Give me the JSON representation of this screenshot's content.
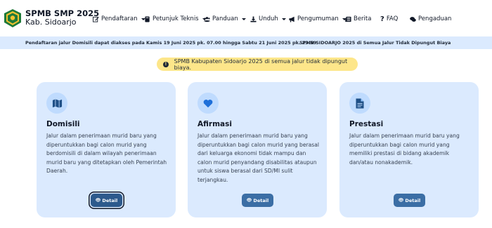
{
  "brand": {
    "title": "SPMB SMP 2025",
    "subtitle": "Kab. Sidoarjo"
  },
  "nav": {
    "items": [
      {
        "label": "Pendaftaran",
        "icon": "edit-icon",
        "dropdown": true
      },
      {
        "label": "Petunjuk Teknis",
        "icon": "book-icon",
        "dropdown": true
      },
      {
        "label": "Panduan",
        "icon": "users-icon",
        "dropdown": true
      },
      {
        "label": "Unduh",
        "icon": "download-icon",
        "dropdown": true
      },
      {
        "label": "Pengumuman",
        "icon": "megaphone-icon",
        "dropdown": true
      },
      {
        "label": "Berita",
        "icon": "newspaper-icon",
        "dropdown": false
      },
      {
        "label": "FAQ",
        "icon": "question-icon",
        "dropdown": false
      },
      {
        "label": "Pengaduan",
        "icon": "comments-icon",
        "dropdown": false
      }
    ]
  },
  "ticker": {
    "items": [
      "Pendaftaran jalur Domisili dapat diakses pada Kamis 19 Juni 2025 pk. 07.00 hingga Sabtu 21 Juni 2025 pk. 23.59",
      "SPMB SIDOARJO 2025 di Semua Jalur Tidak Dipungut Biaya"
    ]
  },
  "alert": {
    "text": "SPMB Kabupaten Sidoarjo 2025 di semua jalur tidak dipungut biaya.",
    "icon": "warning-icon"
  },
  "cards": [
    {
      "title": "Domisili",
      "icon": "map-icon",
      "description": "Jalur dalam penerimaan murid baru yang diperuntukkan bagi calon murid yang berdomisili di dalam wilayah penerimaan murid baru yang ditetapkan oleh Pemerintah Daerah.",
      "button": "Detail"
    },
    {
      "title": "Afirmasi",
      "icon": "heart-icon",
      "description": "Jalur dalam penerimaan murid baru yang diperuntukkan bagi calon murid yang berasal dari keluarga ekonomi tidak mampu dan calon murid penyandang disabilitas ataupun untuk siswa berasal dari SD/MI sulit terjangkau.",
      "button": "Detail"
    },
    {
      "title": "Prestasi",
      "icon": "document-icon",
      "description": "Jalur dalam penerimaan murid baru yang diperuntukkan bagi calon murid yang memiliki prestasi di bidang akademik dan/atau nonakademik.",
      "button": "Detail"
    }
  ],
  "colors": {
    "primary": "#3b6ea5",
    "card_bg": "#dbeafe",
    "alert_bg": "#fde68a",
    "ticker_bg": "#dbeafe"
  }
}
